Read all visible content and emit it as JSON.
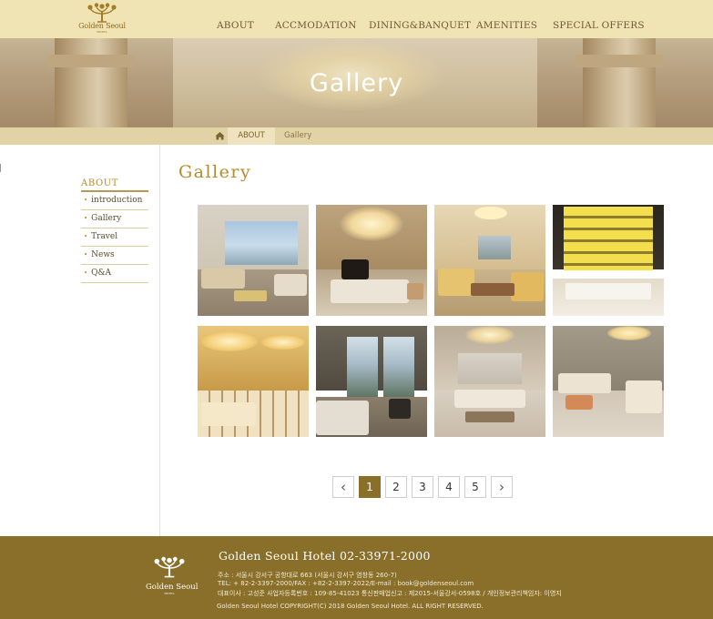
{
  "brand": {
    "name": "Golden Seoul",
    "sub": "HOTEL"
  },
  "nav": {
    "items": [
      "ABOUT",
      "ACCMODATION",
      "DINING&BANQUET",
      "AMENITIES",
      "SPECIAL OFFERS"
    ]
  },
  "banner": {
    "title": "Gallery"
  },
  "breadcrumb": {
    "home_icon": "home-icon",
    "level1": "ABOUT",
    "level2": "Gallery"
  },
  "sidebar": {
    "title": "ABOUT",
    "items": [
      "introduction",
      "Gallery",
      "Travel",
      "News",
      "Q&A"
    ]
  },
  "main": {
    "title": "Gallery",
    "photos": [
      "hotel lounge with sea view",
      "lounge with grand piano",
      "suite living room",
      "bar with illuminated shelves",
      "restaurant with round lights",
      "bedroom with mountain view",
      "suite with chandelier",
      "suite living area"
    ]
  },
  "pagination": {
    "prev": "‹",
    "next": "›",
    "pages": [
      "1",
      "2",
      "3",
      "4",
      "5"
    ],
    "current": "1"
  },
  "footer": {
    "title": "Golden Seoul Hotel 02-33971-2000",
    "line1": "주소 : 서울시 강서구 공항대로 663 (서울시 강서구 염창동 260-7)",
    "line2": "TEL: + 82-2-3397-2000/FAX : +82-2-3397-2022/E-mail : book@goldenseoul.com",
    "line3": "대표이사 : 고성준 사업자등록번호 : 109-85-41023 통신판매업신고 : 제2015-서울강서-0598호 / 개인정보관리책임자: 이영지",
    "copyright": "Golden Seoul Hotel COPYRIGHT(C) 2018 Golden Seoul Hotel. ALL RIGHT RESERVED."
  },
  "colors": {
    "header_bg": "#f1e4b4",
    "accent_gold": "#b58b2e",
    "footer_bg": "#8a6f2a",
    "active_page": "#8a6f2a"
  }
}
